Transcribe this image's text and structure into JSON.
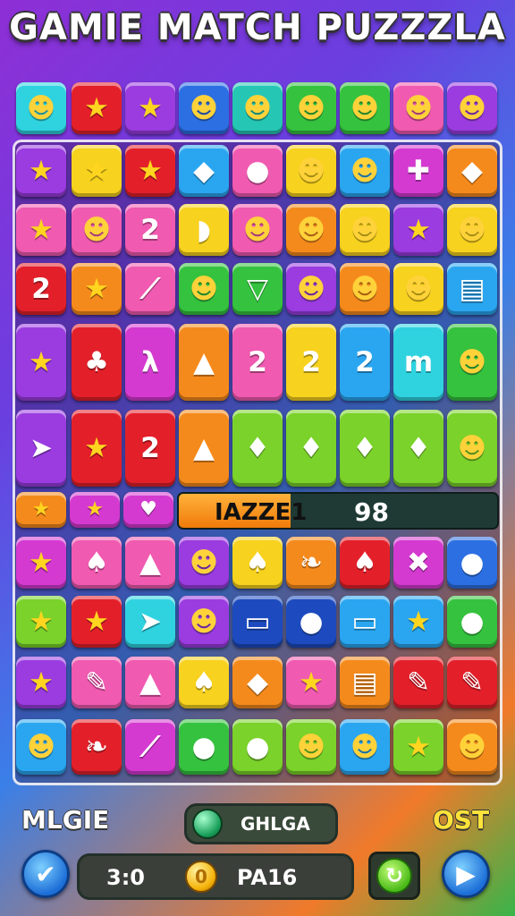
{
  "title": "GAMIE MATCH PUZZZLA",
  "board_rows": [
    [
      "cyan",
      "red",
      "purple",
      "blue",
      "teal",
      "green",
      "green",
      "pink",
      "purple"
    ],
    [
      "purple",
      "yellow",
      "red",
      "sky",
      "pink",
      "yellow",
      "sky",
      "magenta",
      "orange"
    ],
    [
      "pink",
      "pink",
      "pink",
      "yellow",
      "pink",
      "orange",
      "yellow",
      "purple",
      "yellow"
    ],
    [
      "red",
      "orange",
      "pink",
      "green",
      "green",
      "purple",
      "orange",
      "yellow",
      "sky"
    ],
    [
      "purple",
      "red",
      "magenta",
      "orange",
      "pink",
      "yellow",
      "sky",
      "cyan",
      "green"
    ],
    [
      "purple",
      "red",
      "red",
      "orange",
      "lime",
      "lime",
      "lime",
      "lime",
      "lime"
    ],
    [
      "magenta",
      "pink",
      "pink",
      "purple",
      "yellow",
      "orange",
      "red",
      "magenta",
      "blue"
    ],
    [
      "lime",
      "red",
      "cyan",
      "purple",
      "navy",
      "navy",
      "sky",
      "sky",
      "green"
    ],
    [
      "purple",
      "pink",
      "pink",
      "yellow",
      "orange",
      "pink",
      "orange",
      "red",
      "red"
    ],
    [
      "sky",
      "red",
      "magenta",
      "green",
      "lime",
      "lime",
      "sky",
      "lime",
      "orange"
    ]
  ],
  "board_icons": [
    [
      "face-icon",
      "star-icon",
      "star-icon",
      "face-icon",
      "face-icon",
      "face-icon",
      "face-icon",
      "face-icon",
      "face-icon"
    ],
    [
      "star-icon",
      "star-icon",
      "star-icon",
      "kite-icon",
      "fruit-icon",
      "face-icon",
      "face-icon",
      "puzzle-icon",
      "kite-icon"
    ],
    [
      "star-icon",
      "face-icon",
      "number-icon",
      "blob-icon",
      "face-icon",
      "face-icon",
      "face-icon",
      "star-icon",
      "face-icon"
    ],
    [
      "number-icon",
      "star-icon",
      "feather-icon",
      "face-icon",
      "cone-icon",
      "face-icon",
      "face-icon",
      "face-icon",
      "candy-icon"
    ],
    [
      "star-icon",
      "plant-icon",
      "figure-icon",
      "carrot-icon",
      "number-icon",
      "number-icon",
      "number-icon",
      "glyph-icon",
      "face-icon"
    ],
    [
      "arrow-icon",
      "star-icon",
      "number-icon",
      "carrot-icon",
      "flame-icon",
      "flame-icon",
      "flame-icon",
      "flame-icon",
      "face-icon"
    ],
    [
      "star-icon",
      "lollipop-icon",
      "carrot-icon",
      "face-icon",
      "lollipop-icon",
      "leaf-icon",
      "lollipop-icon",
      "cross-icon",
      "ball-icon"
    ],
    [
      "star-icon",
      "star-icon",
      "arrow-icon",
      "face-icon",
      "card-icon",
      "fruit-icon",
      "card-icon",
      "star-icon",
      "fruit-icon"
    ],
    [
      "star-icon",
      "pencil-icon",
      "carrot-icon",
      "lollipop-icon",
      "gem-icon",
      "star-icon",
      "candy-icon",
      "pencil-icon",
      "pencil-icon"
    ],
    [
      "face-icon",
      "leaf-icon",
      "feather-icon",
      "apple-icon",
      "fruit-icon",
      "face-icon",
      "face-icon",
      "star-icon",
      "face-icon"
    ]
  ],
  "powerup_icons": [
    "star-icon",
    "star-icon",
    "heart-icon"
  ],
  "progress": {
    "label": "IAZZE1",
    "symbol": "98",
    "fill_fraction": 0.35
  },
  "bottom": {
    "left_label": "MLGIE",
    "right_label": "OST",
    "center_pill_label": "GHLGA",
    "score": "3:0",
    "level": "PA16"
  },
  "glyphs": {
    "face-icon": "☻",
    "star-icon": "★",
    "kite-icon": "◆",
    "fruit-icon": "●",
    "puzzle-icon": "✚",
    "number-icon": "2",
    "blob-icon": "◗",
    "feather-icon": "⟋",
    "cone-icon": "▽",
    "candy-icon": "▤",
    "plant-icon": "♣",
    "figure-icon": "λ",
    "carrot-icon": "▲",
    "glyph-icon": "m",
    "arrow-icon": "➤",
    "flame-icon": "♦",
    "lollipop-icon": "♠",
    "leaf-icon": "❧",
    "cross-icon": "✖",
    "ball-icon": "●",
    "card-icon": "▭",
    "pencil-icon": "✎",
    "gem-icon": "◆",
    "apple-icon": "●",
    "heart-icon": "♥"
  },
  "colors": {
    "cyan": "#2fd3e0",
    "red": "#e3202a",
    "purple": "#9a3ce0",
    "blue": "#2c6fe3",
    "teal": "#25c7b4",
    "green": "#35c23f",
    "pink": "#f05ab0",
    "sky": "#2aa6f0",
    "yellow": "#f7d21e",
    "orange": "#f58a1c",
    "magenta": "#d43ad0",
    "lime": "#7ad22a",
    "navy": "#1d4bbf"
  }
}
